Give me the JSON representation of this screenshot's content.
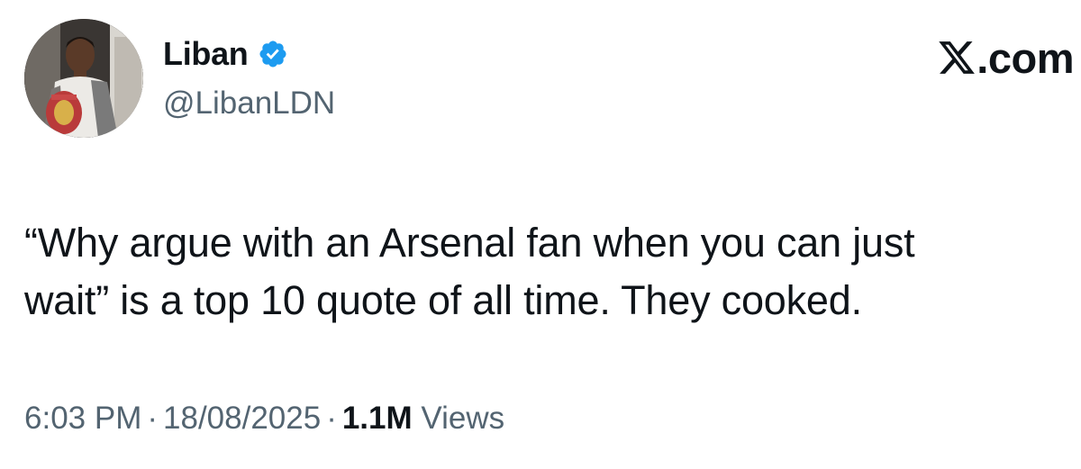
{
  "author": {
    "display_name": "Liban",
    "handle": "@LibanLDN",
    "verified": true
  },
  "brand": {
    "suffix": ".com"
  },
  "tweet": {
    "text": "“Why argue with an Arsenal fan when you can just\nwait” is a top 10 quote of all time. They cooked."
  },
  "meta": {
    "time": "6:03 PM",
    "separator": "·",
    "date": "18/08/2025",
    "views_count": "1.1M",
    "views_label": "Views"
  },
  "colors": {
    "verified_blue": "#1d9bf0",
    "text_primary": "#0f1419",
    "text_secondary": "#536471"
  },
  "icons": {
    "verified": "verified-badge-icon",
    "brand": "x-logo-icon"
  }
}
